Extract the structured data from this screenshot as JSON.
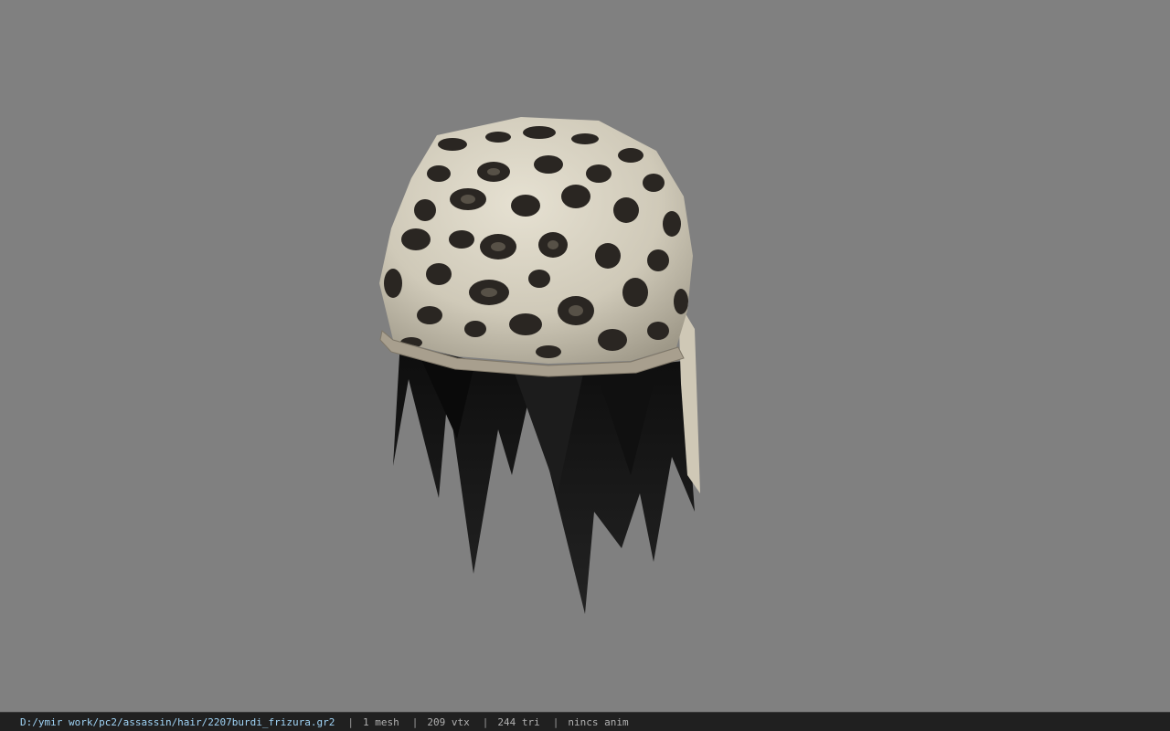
{
  "viewer": {
    "background_color": "#808080",
    "model_name": "2207burdi_frizura",
    "model_parts": {
      "bandana_icon": "leopard-bandana",
      "hair_icon": "dark-hair"
    },
    "colors": {
      "bandana_base": "#d8d3c2",
      "bandana_spot": "#2a2622",
      "bandana_rim": "#a89f8e",
      "hair": "#151515"
    }
  },
  "status_bar": {
    "path": "D:/ymir work/pc2/assassin/hair/2207burdi_frizura.gr2",
    "separator": "|",
    "mesh": "1 mesh",
    "vertices": "209 vtx",
    "triangles": "244 tri",
    "animation": "nincs anim"
  }
}
